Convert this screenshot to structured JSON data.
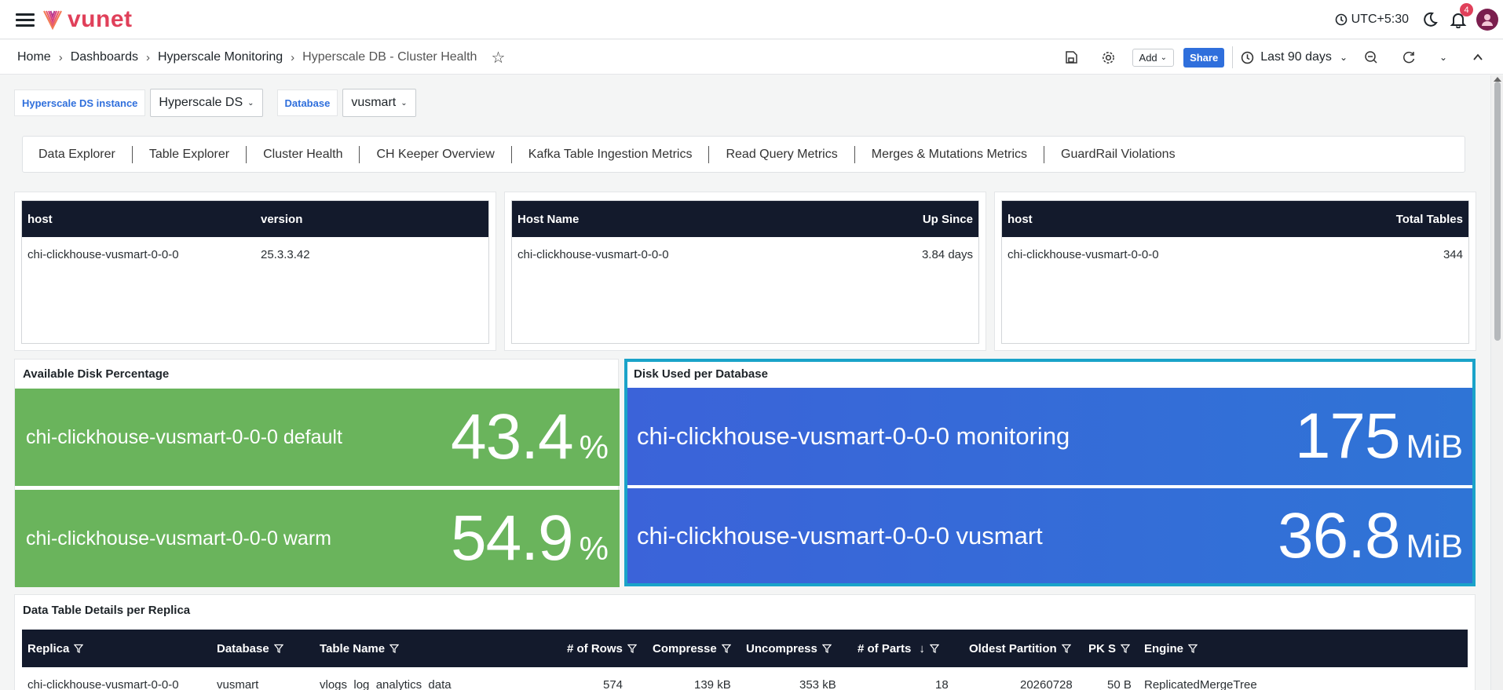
{
  "app": {
    "logo_text": "vunet",
    "timezone": "UTC+5:30",
    "notification_count": "4"
  },
  "breadcrumb": {
    "items": [
      "Home",
      "Dashboards",
      "Hyperscale Monitoring"
    ],
    "current": "Hyperscale DB - Cluster Health"
  },
  "toolbar": {
    "add_label": "Add",
    "share_label": "Share",
    "time_range": "Last 90 days"
  },
  "variables": [
    {
      "label": "Hyperscale DS instance",
      "value": "Hyperscale DS"
    },
    {
      "label": "Database",
      "value": "vusmart"
    }
  ],
  "tabs": [
    "Data Explorer",
    "Table Explorer",
    "Cluster Health",
    "CH Keeper Overview",
    "Kafka Table Ingestion Metrics",
    "Read Query Metrics",
    "Merges & Mutations Metrics",
    "GuardRail Violations"
  ],
  "version_table": {
    "columns": [
      "host",
      "version"
    ],
    "rows": [
      [
        "chi-clickhouse-vusmart-0-0-0",
        "25.3.3.42"
      ]
    ]
  },
  "uptime_table": {
    "columns": [
      "Host Name",
      "Up Since"
    ],
    "rows": [
      [
        "chi-clickhouse-vusmart-0-0-0",
        "3.84 days"
      ]
    ]
  },
  "tables_table": {
    "columns": [
      "host",
      "Total Tables"
    ],
    "rows": [
      [
        "chi-clickhouse-vusmart-0-0-0",
        "344"
      ]
    ]
  },
  "disk_available": {
    "title": "Available Disk Percentage",
    "items": [
      {
        "label": "chi-clickhouse-vusmart-0-0-0 default",
        "value": "43.4",
        "unit": "%"
      },
      {
        "label": "chi-clickhouse-vusmart-0-0-0 warm",
        "value": "54.9",
        "unit": "%"
      }
    ],
    "color": "#6ab45c"
  },
  "disk_used": {
    "title": "Disk Used per Database",
    "items": [
      {
        "label": "chi-clickhouse-vusmart-0-0-0 monitoring",
        "value": "175",
        "unit": "MiB"
      },
      {
        "label": "chi-clickhouse-vusmart-0-0-0 vusmart",
        "value": "36.8",
        "unit": "MiB"
      }
    ],
    "color": "#3b63d9",
    "highlight_color": "#1aa3c9"
  },
  "data_table": {
    "title": "Data Table Details per Replica",
    "columns": [
      "Replica",
      "Database",
      "Table Name",
      "# of Rows",
      "Compresse",
      "Uncompress",
      "# of Parts",
      "Oldest Partition",
      "PK S",
      "Engine"
    ],
    "rows": [
      [
        "chi-clickhouse-vusmart-0-0-0",
        "vusmart",
        "vlogs_log_analytics_data",
        "574",
        "139 kB",
        "353 kB",
        "18",
        "20260728",
        "50 B",
        "ReplicatedMergeTree"
      ]
    ]
  }
}
